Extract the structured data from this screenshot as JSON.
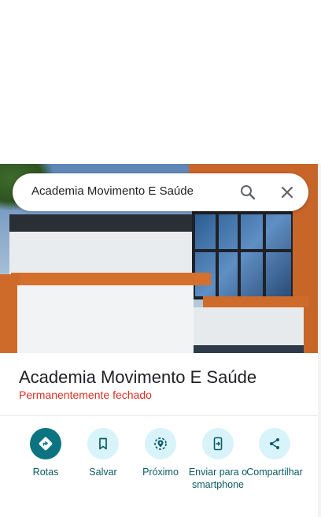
{
  "search": {
    "query": "Academia Movimento E Saúde",
    "search_icon": "search-icon",
    "close_icon": "close-icon"
  },
  "place": {
    "name": "Academia Movimento E Saúde",
    "status": "Permanentemente fechado",
    "status_color": "#d93025"
  },
  "actions": [
    {
      "label": "Rotas",
      "icon": "directions-icon"
    },
    {
      "label": "Salvar",
      "icon": "bookmark-icon"
    },
    {
      "label": "Próximo",
      "icon": "nearby-icon"
    },
    {
      "label": "Enviar para o smartphone",
      "icon": "send-to-phone-icon"
    },
    {
      "label": "Compartilhar",
      "icon": "share-icon"
    }
  ],
  "colors": {
    "accent": "#0b7480",
    "action_bg": "#d8f3fa",
    "label": "#0b5b63"
  }
}
